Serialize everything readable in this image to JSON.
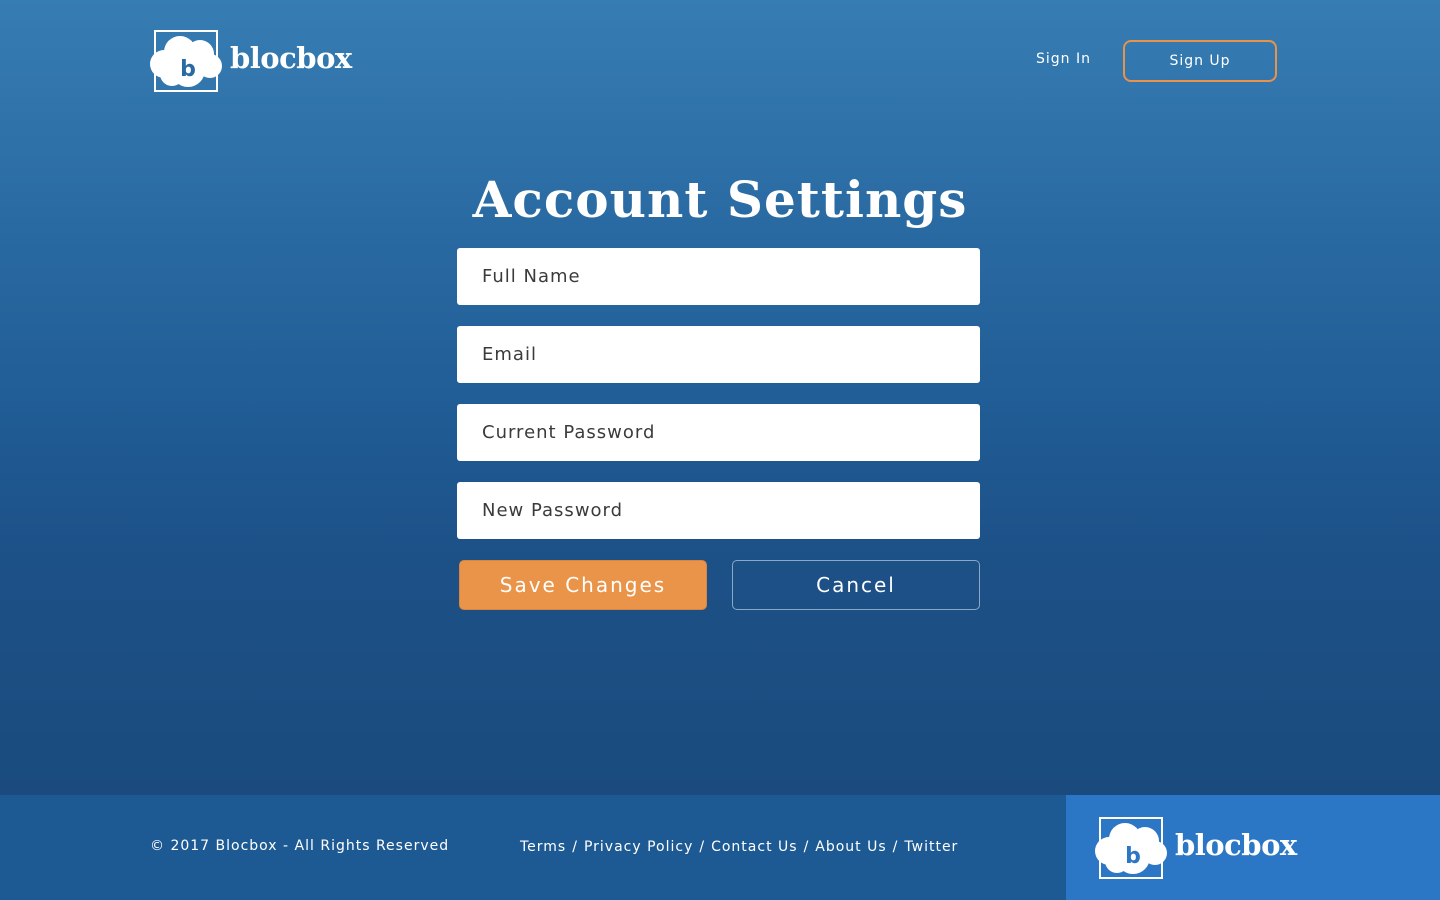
{
  "header": {
    "brand": "blocbox",
    "logo_icon": "cloud-b-icon",
    "nav": {
      "sign_in": "Sign In",
      "sign_up": "Sign Up"
    }
  },
  "main": {
    "title": "Account Settings",
    "form": {
      "full_name": {
        "value": "",
        "placeholder": "Full Name"
      },
      "email": {
        "value": "",
        "placeholder": "Email"
      },
      "current_password": {
        "value": "",
        "placeholder": "Current Password"
      },
      "new_password": {
        "value": "",
        "placeholder": "New Password"
      },
      "save_label": "Save Changes",
      "cancel_label": "Cancel"
    }
  },
  "footer": {
    "copyright": "© 2017 Blocbox - All Rights Reserved",
    "links": [
      "Terms",
      "Privacy Policy",
      "Contact Us",
      "About Us",
      "Twitter"
    ],
    "separator": "/",
    "brand": "blocbox"
  },
  "colors": {
    "accent": "#ea944a",
    "background_top": "#367db3",
    "background_bottom": "#1b4b7e",
    "footer_bg": "#1d5a94",
    "footer_brand_bg": "#2b77c5"
  }
}
